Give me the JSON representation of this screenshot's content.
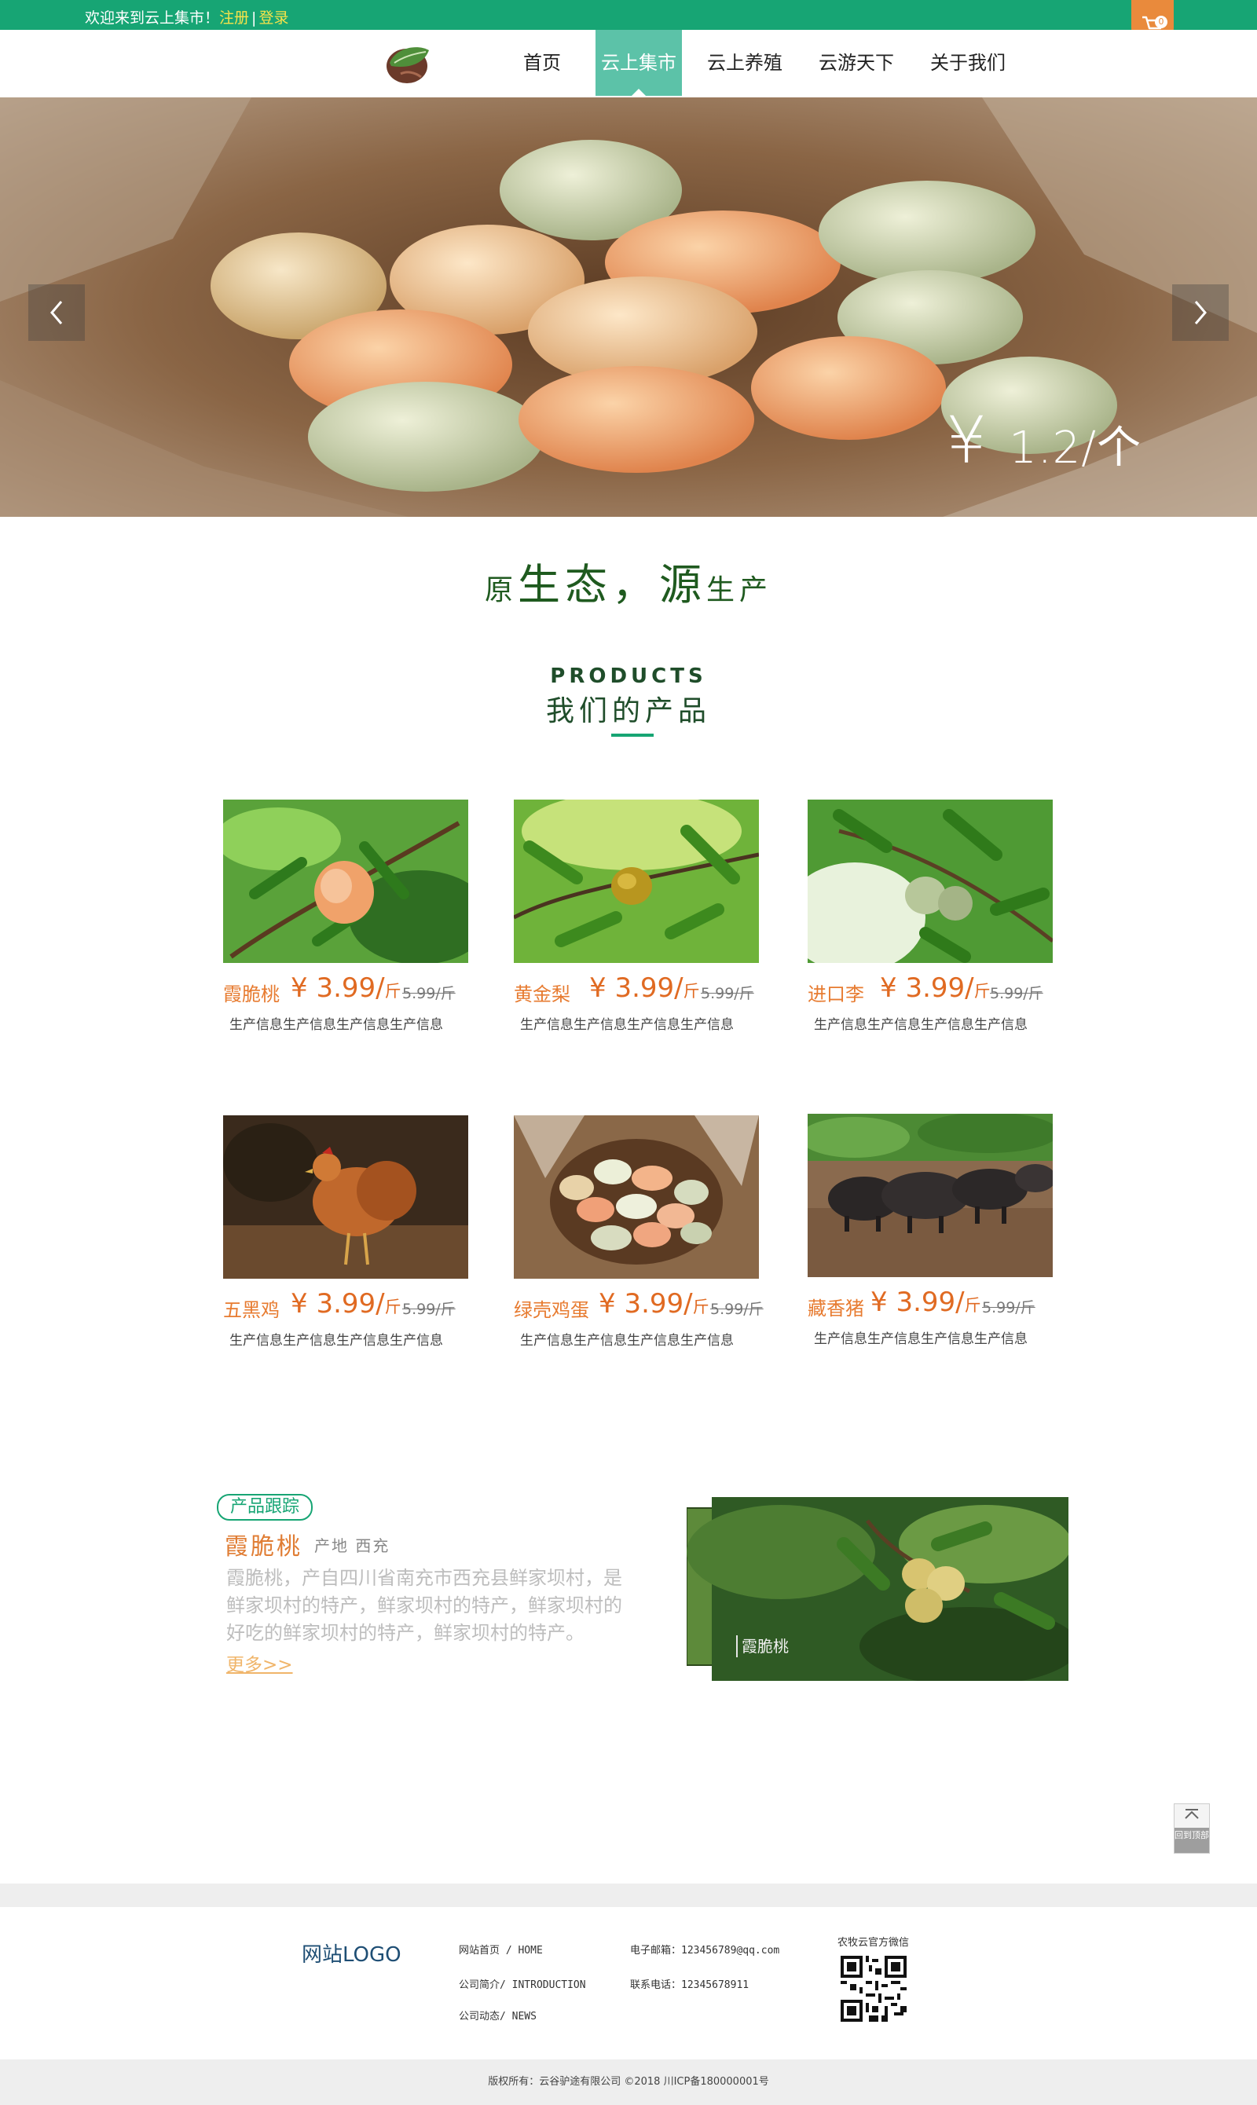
{
  "topbar": {
    "welcome": "欢迎来到云上集市！",
    "register": "注册",
    "separator": "|",
    "login": "登录",
    "cart_count": "0",
    "color": "#17a574"
  },
  "nav": {
    "items": [
      {
        "label": "首页",
        "active": false
      },
      {
        "label": "云上集市",
        "active": true
      },
      {
        "label": "云上养殖",
        "active": false
      },
      {
        "label": "云游天下",
        "active": false
      },
      {
        "label": "关于我们",
        "active": false
      }
    ],
    "active_color": "#5cc2a8"
  },
  "banner": {
    "currency": "¥",
    "price": "1.2/个",
    "prev_icon": "chevron-left-icon",
    "next_icon": "chevron-right-icon"
  },
  "slogan": {
    "part1": "原",
    "part2": "生态，源",
    "part3": "生产"
  },
  "products_section": {
    "title_en": "PRODUCTS",
    "title_cn": "我们的产品"
  },
  "products": [
    {
      "name": "霞脆桃",
      "price": "¥ 3.99/",
      "unit": "斤",
      "old_price": "5.99/斤",
      "desc": "生产信息生产信息生产信息生产信息"
    },
    {
      "name": "黄金梨",
      "price": "¥ 3.99/",
      "unit": "斤",
      "old_price": "5.99/斤",
      "desc": "生产信息生产信息生产信息生产信息"
    },
    {
      "name": "进口李",
      "price": "¥ 3.99/",
      "unit": "斤",
      "old_price": "5.99/斤",
      "desc": "生产信息生产信息生产信息生产信息"
    },
    {
      "name": "五黑鸡",
      "price": "¥ 3.99/",
      "unit": "斤",
      "old_price": "5.99/斤",
      "desc": "生产信息生产信息生产信息生产信息"
    },
    {
      "name": "绿壳鸡蛋",
      "price": "¥ 3.99/",
      "unit": "斤",
      "old_price": "5.99/斤",
      "desc": "生产信息生产信息生产信息生产信息"
    },
    {
      "name": "藏香猪",
      "price": "¥ 3.99/",
      "unit": "斤",
      "old_price": "5.99/斤",
      "desc": "生产信息生产信息生产信息生产信息"
    }
  ],
  "tracking": {
    "badge": "产品跟踪",
    "name": "霞脆桃",
    "origin": "产地 西充",
    "description": "霞脆桃，产自四川省南充市西充县鲜家坝村，是鲜家坝村的特产，鲜家坝村的特产，鲜家坝村的好吃的鲜家坝村的特产，鲜家坝村的特产。",
    "more": "更多>>",
    "image_caption": "霞脆桃"
  },
  "back_to_top": {
    "label": "回到顶部",
    "icon": "arrow-up-icon"
  },
  "footer": {
    "logo": "网站LOGO",
    "links": {
      "home": "网站首页 / HOME",
      "intro": "公司简介/ INTRODUCTION",
      "news": "公司动态/ NEWS",
      "email": "电子邮箱：123456789@qq.com",
      "phone": "联系电话：12345678911"
    },
    "qr_title": "农牧云官方微信",
    "copyright": "版权所有：云谷驴途有限公司   ©2018 川ICP备180000001号"
  }
}
